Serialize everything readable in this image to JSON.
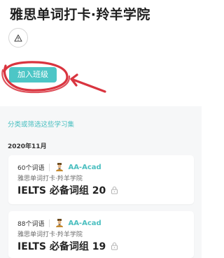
{
  "header": {
    "title": "雅思单词打卡·羚羊学院"
  },
  "actions": {
    "join_label": "加入班级",
    "report_icon": "warning-triangle-icon"
  },
  "filter": {
    "label": "分类或筛选这些学习集"
  },
  "month": "2020年11月",
  "sets": [
    {
      "word_count": "60个词语",
      "owner": "AA-Acad",
      "class_name": "雅思单词打卡·羚羊学院",
      "title": "IELTS 必备词组 20",
      "icon": "lock-icon"
    },
    {
      "word_count": "88个词语",
      "owner": "AA-Acad",
      "class_name": "雅思单词打卡·羚羊学院",
      "title": "IELTS 必备词组 19",
      "icon": "lock-icon"
    }
  ],
  "colors": {
    "accent": "#4dc6c6",
    "annotation": "#d9343f",
    "background_gray": "#f6f7f8"
  }
}
